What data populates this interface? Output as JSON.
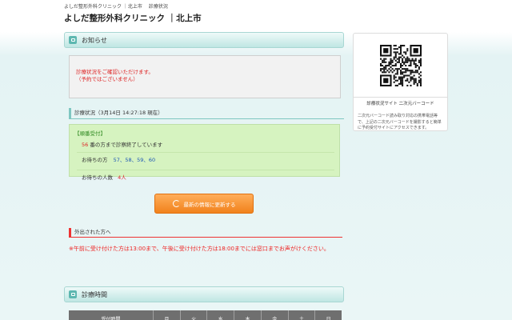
{
  "header": {
    "breadcrumb": "よしだ整形外科クリニック ｜北上市　 診療状況",
    "title": "よしだ整形外科クリニック ｜北上市"
  },
  "notice": {
    "heading": "お知らせ",
    "line1": "診療状況をご確認いただけます。",
    "line2": "（予約ではございません）"
  },
  "status": {
    "heading": "診療状況（3月14日 14:27:18 現在）",
    "reception_label": "【順番受付】",
    "current_number": "56",
    "current_suffix": "番の方まで診察終了しています",
    "waiting_label": "お待ちの方",
    "waiting_numbers": "57、58、59、60",
    "count_label": "お待ちの人数",
    "count_value": "4人"
  },
  "refresh_button": {
    "label": "最新の情報に更新する"
  },
  "outing": {
    "heading": "外出された方へ",
    "text": "※午前に受け付けた方は13:00まで、午後に受け付けた方は18:00までには窓口までお声がけください。"
  },
  "hours": {
    "heading": "診療時間",
    "columns": [
      "受付時間",
      "月",
      "火",
      "水",
      "木",
      "金",
      "土",
      "日"
    ]
  },
  "side": {
    "qr_caption": "診療状況サイト 二次元バーコード",
    "description": "二次元バーコード読み取り対応の携帯電話等で、上記の二次元バーコードを撮影すると簡単に予約受付サイトにアクセスできます。"
  },
  "colors": {
    "accent": "#5db7b0",
    "alert": "#dd2222",
    "status_bg": "#d6f3c0",
    "button": "#f1821c"
  }
}
